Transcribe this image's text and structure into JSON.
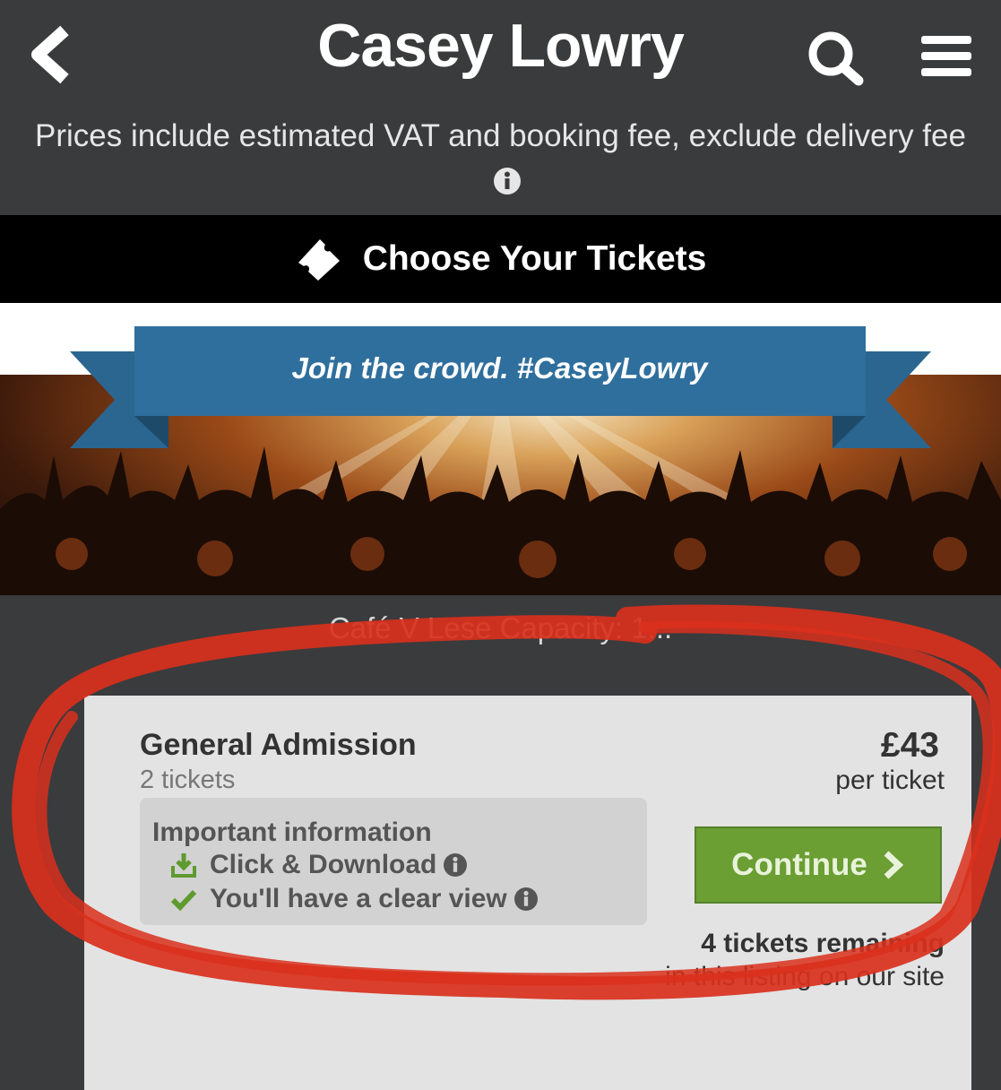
{
  "header": {
    "title": "Casey Lowry",
    "notice": "Prices include estimated VAT and booking fee, exclude delivery fee"
  },
  "choose": {
    "label": "Choose Your Tickets"
  },
  "banner": {
    "text": "Join the crowd. #CaseyLowry"
  },
  "venue": {
    "text": "Café V Lese Capacity: 1..."
  },
  "listing": {
    "name": "General Admission",
    "quantity": "2 tickets",
    "price": "£43",
    "price_unit": "per ticket",
    "info_title": "Important information",
    "features": [
      "Click & Download",
      "You'll have a clear view"
    ],
    "button_label": "Continue",
    "remaining_bold": "4 tickets remaining",
    "remaining_rest": "in this listing on our site"
  },
  "colors": {
    "accent_green": "#6b9e33",
    "banner_blue": "#2f6f9d",
    "annotation_red": "#d9301c"
  }
}
